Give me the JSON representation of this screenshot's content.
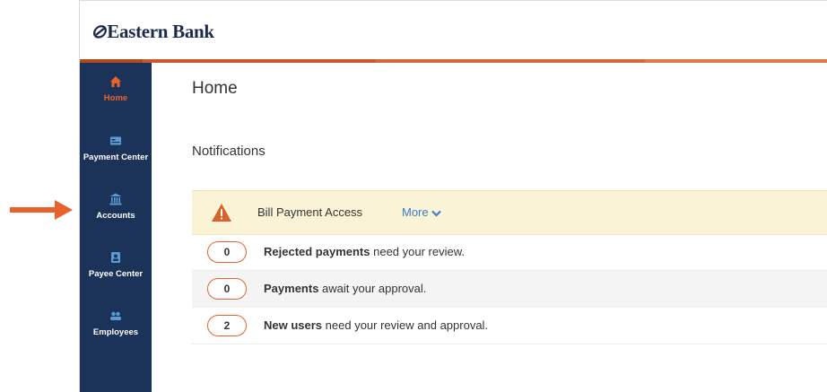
{
  "header": {
    "logo_mark": "⊘",
    "logo_text": "Eastern Bank"
  },
  "colors": {
    "brand_orange": "#e8632b",
    "sidebar_navy": "#1b3358",
    "stripe_dark": "#b24a1e",
    "stripe_mid": "#c75a2c",
    "alert_bg": "#fbf3d5",
    "link_blue": "#3d7cc9",
    "active_label": "#e8632b"
  },
  "sidebar": {
    "items": [
      {
        "label": "Home",
        "icon": "home-icon",
        "active": true
      },
      {
        "label": "Payment Center",
        "icon": "payment-center-icon",
        "active": false
      },
      {
        "label": "Accounts",
        "icon": "bank-building-icon",
        "active": false
      },
      {
        "label": "Payee Center",
        "icon": "payee-icon",
        "active": false
      },
      {
        "label": "Employees",
        "icon": "users-icon",
        "active": false
      }
    ]
  },
  "main": {
    "title": "Home",
    "notifications_title": "Notifications",
    "alert": {
      "title": "Bill Payment Access",
      "more_label": "More",
      "icon": "warning-icon"
    },
    "rows": [
      {
        "count": "0",
        "bold": "Rejected payments",
        "rest": " need your review."
      },
      {
        "count": "0",
        "bold": "Payments",
        "rest": " await your approval."
      },
      {
        "count": "2",
        "bold": "New users",
        "rest": " need your review and approval."
      }
    ]
  },
  "annotation": {
    "icon": "right-arrow-icon"
  }
}
